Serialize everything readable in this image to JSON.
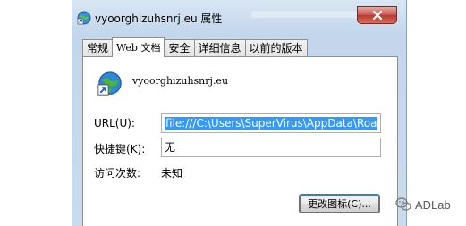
{
  "window": {
    "title": "vyoorghizuhsnrj.eu 属性"
  },
  "tabs": [
    {
      "label": "常规"
    },
    {
      "label": "Web 文档"
    },
    {
      "label": "安全"
    },
    {
      "label": "详细信息"
    },
    {
      "label": "以前的版本"
    }
  ],
  "active_tab_index": 1,
  "file": {
    "name": "vyoorghizuhsnrj.eu",
    "icon": "internet-shortcut-icon"
  },
  "form": {
    "url_label": "URL(U):",
    "url_value": "file:///C:\\Users\\SuperVirus\\AppData\\Roa",
    "shortcut_label": "快捷键(K):",
    "shortcut_value": "无",
    "visits_label": "访问次数:",
    "visits_value": "未知"
  },
  "buttons": {
    "change_icon": "更改图标(C)..."
  },
  "watermark": {
    "text": "ADLab"
  },
  "colors": {
    "selection": "#3399ff",
    "close_button": "#c75050",
    "title_bar": "#c3d6ec"
  }
}
